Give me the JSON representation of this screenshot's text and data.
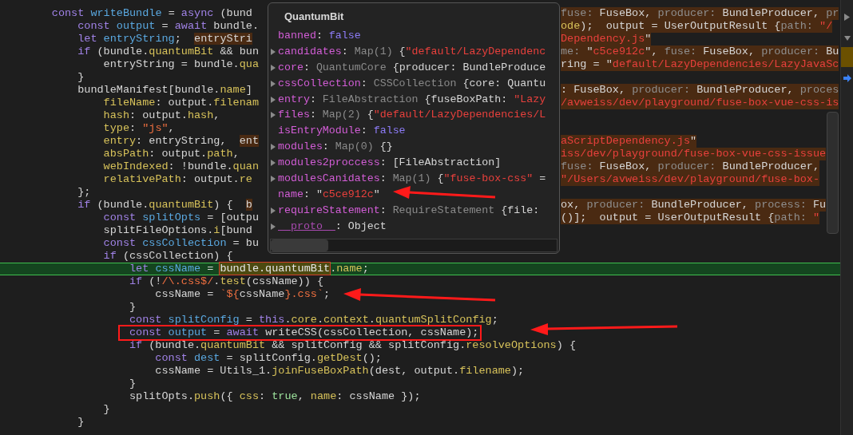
{
  "editor": {
    "lines": [
      {
        "current": false,
        "tokens": [
          {
            "kind": "kw",
            "text": "const"
          },
          {
            "kind": "decl",
            "text": " writeBundle"
          },
          {
            "kind": "txt",
            "text": " = "
          },
          {
            "kind": "kw",
            "text": "async"
          },
          {
            "kind": "txt",
            "text": " (bund"
          }
        ],
        "inline_value": [
          {
            "kind": "dim",
            "text": "fuse: "
          },
          {
            "kind": "txt",
            "text": "FuseBox, "
          },
          {
            "kind": "dim",
            "text": "producer: "
          },
          {
            "kind": "txt",
            "text": "BundleProducer, "
          },
          {
            "kind": "dim",
            "text": "pr"
          }
        ],
        "children": [
          {
            "current": false,
            "tokens": [
              {
                "kind": "kw",
                "text": "const"
              },
              {
                "kind": "decl",
                "text": " output"
              },
              {
                "kind": "txt",
                "text": " = "
              },
              {
                "kind": "kw",
                "text": "await"
              },
              {
                "kind": "txt",
                "text": " bundle."
              }
            ],
            "inline_value": [
              {
                "kind": "prop",
                "text": "ode"
              },
              {
                "kind": "txt",
                "text": ");  output = UserOutputResult {"
              },
              {
                "kind": "dim",
                "text": "path: "
              },
              {
                "kind": "red",
                "text": "\"/"
              }
            ]
          },
          {
            "current": false,
            "tokens": [
              {
                "kind": "kw",
                "text": "let"
              },
              {
                "kind": "decl",
                "text": " entryString"
              },
              {
                "kind": "txt",
                "text": ";  "
              },
              {
                "kind": "hint",
                "text": "entryStri"
              }
            ],
            "inline_value": [
              {
                "kind": "red",
                "text": "Dependency.js"
              },
              {
                "kind": "txt",
                "text": "\""
              }
            ]
          },
          {
            "current": false,
            "tokens": [
              {
                "kind": "kw",
                "text": "if"
              },
              {
                "kind": "txt",
                "text": " (bundle."
              },
              {
                "kind": "prop",
                "text": "quantumBit"
              },
              {
                "kind": "txt",
                "text": " && bun"
              }
            ],
            "inline_value": [
              {
                "kind": "dim",
                "text": "me: "
              },
              {
                "kind": "txt",
                "text": "\""
              },
              {
                "kind": "red",
                "text": "c5ce912c"
              },
              {
                "kind": "txt",
                "text": "\", "
              },
              {
                "kind": "dim",
                "text": "fuse: "
              },
              {
                "kind": "txt",
                "text": "FuseBox, "
              },
              {
                "kind": "dim",
                "text": "producer: "
              },
              {
                "kind": "txt",
                "text": "Bu"
              }
            ],
            "children": [
              {
                "current": false,
                "tokens": [
                  {
                    "kind": "txt",
                    "text": "entryString = bundle."
                  },
                  {
                    "kind": "prop",
                    "text": "qua"
                  }
                ],
                "inline_value": [
                  {
                    "kind": "txt",
                    "text": "ring = \""
                  },
                  {
                    "kind": "red",
                    "text": "default/LazyDependencies/LazyJavaSc"
                  }
                ]
              }
            ]
          },
          {
            "current": false,
            "tokens": [
              {
                "kind": "txt",
                "text": "}"
              }
            ]
          },
          {
            "current": false,
            "tokens": [
              {
                "kind": "txt",
                "text": "bundleManifest[bundle."
              },
              {
                "kind": "prop",
                "text": "name"
              },
              {
                "kind": "txt",
                "text": "]"
              }
            ],
            "inline_value": [
              {
                "kind": "txt",
                "text": ": FuseBox, "
              },
              {
                "kind": "dim",
                "text": "producer: "
              },
              {
                "kind": "txt",
                "text": "BundleProducer, "
              },
              {
                "kind": "dim",
                "text": "proces"
              }
            ],
            "children": [
              {
                "current": false,
                "tokens": [
                  {
                    "kind": "prop",
                    "text": "fileName"
                  },
                  {
                    "kind": "txt",
                    "text": ": output."
                  },
                  {
                    "kind": "prop",
                    "text": "filenam"
                  }
                ],
                "inline_value": [
                  {
                    "kind": "red",
                    "text": "/avweiss/dev/playground/fuse-box-vue-css-is"
                  }
                ]
              },
              {
                "current": false,
                "tokens": [
                  {
                    "kind": "prop",
                    "text": "hash"
                  },
                  {
                    "kind": "txt",
                    "text": ": output."
                  },
                  {
                    "kind": "prop",
                    "text": "hash"
                  },
                  {
                    "kind": "txt",
                    "text": ","
                  }
                ]
              },
              {
                "current": false,
                "tokens": [
                  {
                    "kind": "prop",
                    "text": "type"
                  },
                  {
                    "kind": "txt",
                    "text": ": "
                  },
                  {
                    "kind": "str",
                    "text": "\"js\""
                  },
                  {
                    "kind": "txt",
                    "text": ","
                  }
                ]
              },
              {
                "current": false,
                "tokens": [
                  {
                    "kind": "prop",
                    "text": "entry"
                  },
                  {
                    "kind": "txt",
                    "text": ": entryString,  "
                  },
                  {
                    "kind": "hint",
                    "text": "ent"
                  }
                ],
                "inline_value": [
                  {
                    "kind": "red",
                    "text": "aScriptDependency.js"
                  },
                  {
                    "kind": "txt",
                    "text": "\""
                  }
                ]
              },
              {
                "current": false,
                "tokens": [
                  {
                    "kind": "prop",
                    "text": "absPath"
                  },
                  {
                    "kind": "txt",
                    "text": ": output."
                  },
                  {
                    "kind": "prop",
                    "text": "path"
                  },
                  {
                    "kind": "txt",
                    "text": ","
                  }
                ],
                "inline_value": [
                  {
                    "kind": "red",
                    "text": "iss/dev/playground/fuse-box-vue-css-issue"
                  }
                ]
              },
              {
                "current": false,
                "tokens": [
                  {
                    "kind": "prop",
                    "text": "webIndexed"
                  },
                  {
                    "kind": "txt",
                    "text": ": !bundle."
                  },
                  {
                    "kind": "prop",
                    "text": "quan"
                  }
                ],
                "inline_value": [
                  {
                    "kind": "dim",
                    "text": "fuse: "
                  },
                  {
                    "kind": "txt",
                    "text": "FuseBox, "
                  },
                  {
                    "kind": "dim",
                    "text": "producer: "
                  },
                  {
                    "kind": "txt",
                    "text": "BundleProducer,"
                  }
                ]
              },
              {
                "current": false,
                "tokens": [
                  {
                    "kind": "prop",
                    "text": "relativePath"
                  },
                  {
                    "kind": "txt",
                    "text": ": output."
                  },
                  {
                    "kind": "prop",
                    "text": "re"
                  }
                ],
                "inline_value": [
                  {
                    "kind": "red",
                    "text": "\"/Users/avweiss/dev/playground/fuse-box-"
                  }
                ]
              }
            ]
          },
          {
            "current": false,
            "tokens": [
              {
                "kind": "txt",
                "text": "};"
              }
            ]
          },
          {
            "current": false,
            "tokens": [
              {
                "kind": "kw",
                "text": "if"
              },
              {
                "kind": "txt",
                "text": " (bundle."
              },
              {
                "kind": "prop",
                "text": "quantumBit"
              },
              {
                "kind": "txt",
                "text": ") {  "
              },
              {
                "kind": "hint",
                "text": "b"
              }
            ],
            "inline_value": [
              {
                "kind": "txt",
                "text": "ox, "
              },
              {
                "kind": "dim",
                "text": "producer: "
              },
              {
                "kind": "txt",
                "text": "BundleProducer, "
              },
              {
                "kind": "dim",
                "text": "process: "
              },
              {
                "kind": "txt",
                "text": "Fu"
              }
            ],
            "children": [
              {
                "current": false,
                "tokens": [
                  {
                    "kind": "kw",
                    "text": "const"
                  },
                  {
                    "kind": "decl",
                    "text": " splitOpts"
                  },
                  {
                    "kind": "txt",
                    "text": " = [outpu"
                  }
                ],
                "inline_value": [
                  {
                    "kind": "txt",
                    "text": "()];  output = UserOutputResult {"
                  },
                  {
                    "kind": "dim",
                    "text": "path: "
                  },
                  {
                    "kind": "red",
                    "text": "\""
                  }
                ]
              },
              {
                "current": false,
                "tokens": [
                  {
                    "kind": "txt",
                    "text": "splitFileOptions."
                  },
                  {
                    "kind": "prop",
                    "text": "i"
                  },
                  {
                    "kind": "txt",
                    "text": "[bund"
                  }
                ]
              },
              {
                "current": false,
                "tokens": [
                  {
                    "kind": "kw",
                    "text": "const"
                  },
                  {
                    "kind": "decl",
                    "text": " cssCollection"
                  },
                  {
                    "kind": "txt",
                    "text": " = bu"
                  }
                ]
              },
              {
                "current": false,
                "tokens": [
                  {
                    "kind": "kw",
                    "text": "if"
                  },
                  {
                    "kind": "txt",
                    "text": " (cssCollection) {"
                  }
                ],
                "children": [
                  {
                    "current": true,
                    "tokens": [
                      {
                        "kind": "kw",
                        "text": "let"
                      },
                      {
                        "kind": "decl",
                        "text": " cssName"
                      },
                      {
                        "kind": "txt",
                        "text": " = "
                      },
                      {
                        "kind": "sel",
                        "text": "bundle.quantumBit"
                      },
                      {
                        "kind": "txt",
                        "text": "."
                      },
                      {
                        "kind": "prop",
                        "text": "name"
                      },
                      {
                        "kind": "txt",
                        "text": ";"
                      }
                    ]
                  },
                  {
                    "current": false,
                    "tokens": [
                      {
                        "kind": "kw",
                        "text": "if"
                      },
                      {
                        "kind": "txt",
                        "text": " (!"
                      },
                      {
                        "kind": "str",
                        "text": "/\\.css$/"
                      },
                      {
                        "kind": "txt",
                        "text": "."
                      },
                      {
                        "kind": "prop",
                        "text": "test"
                      },
                      {
                        "kind": "txt",
                        "text": "(cssName)) {"
                      }
                    ],
                    "children": [
                      {
                        "current": false,
                        "tokens": [
                          {
                            "kind": "txt",
                            "text": "cssName = "
                          },
                          {
                            "kind": "str",
                            "text": "`${"
                          },
                          {
                            "kind": "txt",
                            "text": "cssName"
                          },
                          {
                            "kind": "str",
                            "text": "}.css`"
                          },
                          {
                            "kind": "txt",
                            "text": ";"
                          }
                        ]
                      }
                    ]
                  },
                  {
                    "current": false,
                    "tokens": [
                      {
                        "kind": "txt",
                        "text": "}"
                      }
                    ]
                  },
                  {
                    "current": false,
                    "tokens": [
                      {
                        "kind": "kw",
                        "text": "const"
                      },
                      {
                        "kind": "decl",
                        "text": " splitConfig"
                      },
                      {
                        "kind": "txt",
                        "text": " = "
                      },
                      {
                        "kind": "kw",
                        "text": "this"
                      },
                      {
                        "kind": "txt",
                        "text": "."
                      },
                      {
                        "kind": "prop",
                        "text": "core"
                      },
                      {
                        "kind": "txt",
                        "text": "."
                      },
                      {
                        "kind": "prop",
                        "text": "context"
                      },
                      {
                        "kind": "txt",
                        "text": "."
                      },
                      {
                        "kind": "prop",
                        "text": "quantumSplitConfig"
                      },
                      {
                        "kind": "txt",
                        "text": ";"
                      }
                    ]
                  },
                  {
                    "current": false,
                    "tokens": [
                      {
                        "kind": "kw",
                        "text": "const"
                      },
                      {
                        "kind": "decl",
                        "text": " output"
                      },
                      {
                        "kind": "txt",
                        "text": " = "
                      },
                      {
                        "kind": "kw",
                        "text": "await"
                      },
                      {
                        "kind": "txt",
                        "text": " writeCSS(cssCollection, cssName);"
                      }
                    ],
                    "boxed": true
                  },
                  {
                    "current": false,
                    "tokens": [
                      {
                        "kind": "kw",
                        "text": "if"
                      },
                      {
                        "kind": "txt",
                        "text": " (bundle."
                      },
                      {
                        "kind": "prop",
                        "text": "quantumBit"
                      },
                      {
                        "kind": "txt",
                        "text": " && splitConfig && splitConfig."
                      },
                      {
                        "kind": "prop",
                        "text": "resolveOptions"
                      },
                      {
                        "kind": "txt",
                        "text": ") {"
                      }
                    ],
                    "children": [
                      {
                        "current": false,
                        "tokens": [
                          {
                            "kind": "kw",
                            "text": "const"
                          },
                          {
                            "kind": "decl",
                            "text": " dest"
                          },
                          {
                            "kind": "txt",
                            "text": " = splitConfig."
                          },
                          {
                            "kind": "prop",
                            "text": "getDest"
                          },
                          {
                            "kind": "txt",
                            "text": "();"
                          }
                        ]
                      },
                      {
                        "current": false,
                        "tokens": [
                          {
                            "kind": "txt",
                            "text": "cssName = Utils_1."
                          },
                          {
                            "kind": "prop",
                            "text": "joinFuseBoxPath"
                          },
                          {
                            "kind": "txt",
                            "text": "(dest, output."
                          },
                          {
                            "kind": "prop",
                            "text": "filename"
                          },
                          {
                            "kind": "txt",
                            "text": ");"
                          }
                        ]
                      }
                    ]
                  },
                  {
                    "current": false,
                    "tokens": [
                      {
                        "kind": "txt",
                        "text": "}"
                      }
                    ]
                  },
                  {
                    "current": false,
                    "tokens": [
                      {
                        "kind": "txt",
                        "text": "splitOpts."
                      },
                      {
                        "kind": "prop",
                        "text": "push"
                      },
                      {
                        "kind": "txt",
                        "text": "({ "
                      },
                      {
                        "kind": "prop",
                        "text": "css"
                      },
                      {
                        "kind": "txt",
                        "text": ": "
                      },
                      {
                        "kind": "num",
                        "text": "true"
                      },
                      {
                        "kind": "txt",
                        "text": ", "
                      },
                      {
                        "kind": "prop",
                        "text": "name"
                      },
                      {
                        "kind": "txt",
                        "text": ": cssName });"
                      }
                    ]
                  }
                ]
              },
              {
                "current": false,
                "tokens": [
                  {
                    "kind": "txt",
                    "text": "}"
                  }
                ]
              }
            ]
          },
          {
            "current": false,
            "tokens": [
              {
                "kind": "txt",
                "text": "}"
              }
            ]
          }
        ]
      }
    ]
  },
  "popover": {
    "title": "QuantumBit",
    "properties": [
      {
        "kind": "value",
        "key": "banned",
        "value": [
          {
            "kind": "txt",
            "text": ":"
          },
          {
            "kind": "bool",
            "text": " false"
          }
        ]
      },
      {
        "kind": "expandable",
        "key": "candidates",
        "value": [
          {
            "kind": "txt",
            "text": ":"
          },
          {
            "kind": "type",
            "text": " Map(1)"
          },
          {
            "kind": "txt",
            "text": " {"
          },
          {
            "kind": "red",
            "text": "\"default/LazyDependenc"
          }
        ]
      },
      {
        "kind": "expandable",
        "key": "core",
        "value": [
          {
            "kind": "txt",
            "text": ":"
          },
          {
            "kind": "type",
            "text": " QuantumCore"
          },
          {
            "kind": "txt",
            "text": " {producer: BundleProduce"
          }
        ]
      },
      {
        "kind": "expandable",
        "key": "cssCollection",
        "value": [
          {
            "kind": "txt",
            "text": ":"
          },
          {
            "kind": "type",
            "text": " CSSCollection"
          },
          {
            "kind": "txt",
            "text": " {core: Quantu"
          }
        ]
      },
      {
        "kind": "expandable",
        "key": "entry",
        "value": [
          {
            "kind": "txt",
            "text": ":"
          },
          {
            "kind": "type",
            "text": " FileAbstraction"
          },
          {
            "kind": "txt",
            "text": " {fuseBoxPath: "
          },
          {
            "kind": "red",
            "text": "\"Lazy"
          }
        ]
      },
      {
        "kind": "expandable",
        "key": "files",
        "value": [
          {
            "kind": "txt",
            "text": ":"
          },
          {
            "kind": "type",
            "text": " Map(2)"
          },
          {
            "kind": "txt",
            "text": " {"
          },
          {
            "kind": "red",
            "text": "\"default/LazyDependencies/L"
          }
        ]
      },
      {
        "kind": "value",
        "key": "isEntryModule",
        "value": [
          {
            "kind": "txt",
            "text": ":"
          },
          {
            "kind": "bool",
            "text": " false"
          }
        ]
      },
      {
        "kind": "expandable",
        "key": "modules",
        "value": [
          {
            "kind": "txt",
            "text": ":"
          },
          {
            "kind": "type",
            "text": " Map(0)"
          },
          {
            "kind": "txt",
            "text": " {}"
          }
        ]
      },
      {
        "kind": "expandable",
        "key": "modules2proccess",
        "value": [
          {
            "kind": "txt",
            "text": ": [FileAbstraction]"
          }
        ]
      },
      {
        "kind": "expandable",
        "key": "modulesCanidates",
        "value": [
          {
            "kind": "txt",
            "text": ":"
          },
          {
            "kind": "type",
            "text": " Map(1)"
          },
          {
            "kind": "txt",
            "text": " {"
          },
          {
            "kind": "red",
            "text": "\"fuse-box-css\""
          },
          {
            "kind": "txt",
            "text": " ="
          }
        ]
      },
      {
        "kind": "value",
        "key": "name",
        "value": [
          {
            "kind": "txt",
            "text": ": \""
          },
          {
            "kind": "red",
            "text": "c5ce912c"
          },
          {
            "kind": "txt",
            "text": "\""
          }
        ]
      },
      {
        "kind": "expandable",
        "key": "requireStatement",
        "value": [
          {
            "kind": "txt",
            "text": ":"
          },
          {
            "kind": "type",
            "text": " RequireStatement"
          },
          {
            "kind": "txt",
            "text": " {file:"
          }
        ]
      },
      {
        "kind": "proto",
        "key": "__proto__",
        "value": [
          {
            "kind": "txt",
            "text": ": Object"
          }
        ]
      }
    ]
  }
}
